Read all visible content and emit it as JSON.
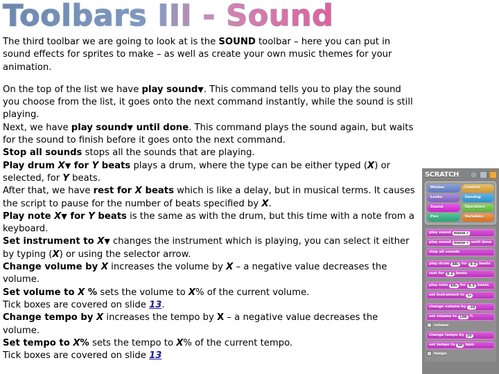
{
  "slide": {
    "title": "Toolbars III - Sound",
    "title_colors": {
      "start": "#7b93b8",
      "end": "#d96fa6"
    },
    "background": "#ffffff"
  },
  "body": {
    "p1": {
      "part1": "The third toolbar we are going to look at is the ",
      "bold1": "SOUND",
      "part2": " toolbar – here you can put in sound effects for sprites to make – as well as create your own music themes for your animation."
    },
    "p2": {
      "l1_a": "On the top of the list we have ",
      "l1_b": "play sound",
      "l1_arrow": "▼",
      "l1_c": ".  This command tells you to play the sound you choose from the list, it goes onto the next command instantly, while the sound is still playing.",
      "l2_a": "Next, we have ",
      "l2_b": "play sound",
      "l2_arrow": "▼",
      "l2_c": " until done",
      "l2_d": ".  This command plays the sound again, but waits for the sound to finish before it goes onto the next command."
    },
    "p3": {
      "b": "Stop all sounds",
      "t": " stops all the sounds that are playing."
    },
    "p4": {
      "b1": "Play drum ",
      "x1": "X",
      "arrow": "▼",
      "b2": " for ",
      "y1": "Y",
      "b3": " beats",
      "t1": " plays a drum, where the type can be either typed (",
      "x2": "X",
      "t2": ") or selected, for ",
      "y2": "Y",
      "t3": " beats."
    },
    "p5": {
      "t1": "After that, we have ",
      "b1": "rest for ",
      "x1": "X",
      "b2": " beats",
      "t2": " which is like a delay, but in musical terms.  It causes the script to pause for the number of beats specified by ",
      "x2": "X",
      "t3": "."
    },
    "p6": {
      "b1": "Play note ",
      "x1": "X",
      "arrow": "▼",
      "b2": " for ",
      "y1": "Y",
      "b3": " beats",
      "t1": " is the same as with the drum, but this time with a note from a keyboard."
    },
    "p7": {
      "b1": "Set instrument to ",
      "x1": "X",
      "arrow": "▼",
      "t1": "  changes the instrument which is playing, you can select it either by typing (",
      "x2": "X",
      "t2": ") or using the selector arrow."
    },
    "p8": {
      "b1": "Change volume by ",
      "x1": "X",
      "t1": " increases the volume by ",
      "x2": "X",
      "t2": " – a negative value decreases the volume."
    },
    "p9": {
      "b1": "Set volume to ",
      "x1": "X",
      "b2": " %",
      "t1": " sets the volume to ",
      "x2": "X",
      "t2": "% of the current volume."
    },
    "p10": {
      "t1": "Tick boxes are covered on slide ",
      "link": "13",
      "t2": "."
    },
    "p11": {
      "b1": "Change tempo by ",
      "x1": "X",
      "t1": " increases the tempo by ",
      "x2": "X",
      "t2": " – a negative value decreases the volume."
    },
    "p12": {
      "b1": "Set tempo to ",
      "x1": "X",
      "b2": "%",
      "t1": " sets the tempo to ",
      "x2": "X",
      "t2": "% of the current tempo."
    },
    "p13": {
      "t1": "Tick boxes are covered on slide ",
      "link": "13"
    }
  },
  "scratch": {
    "logo": "SCRATCH",
    "icons": [
      "globe-icon",
      "save-icon",
      "share-icon"
    ],
    "categories": [
      {
        "label": "Motion",
        "color": "#5f79bd",
        "selected": false
      },
      {
        "label": "Control",
        "color": "#cf9a32",
        "selected": false
      },
      {
        "label": "Looks",
        "color": "#7b5fbd",
        "selected": false
      },
      {
        "label": "Sensing",
        "color": "#2e8fc9",
        "selected": false
      },
      {
        "label": "Sound",
        "color": "#cc22cc",
        "selected": true
      },
      {
        "label": "Operators",
        "color": "#5fb03a",
        "selected": false
      },
      {
        "label": "Pen",
        "color": "#2f9e74",
        "selected": false
      },
      {
        "label": "Variables",
        "color": "#d2701f",
        "selected": false
      }
    ],
    "blocks": [
      {
        "pre": "play sound",
        "field": "meow ▾",
        "post": ""
      },
      {
        "pre": "play sound",
        "field": "meow ▾",
        "post": "until done"
      },
      {
        "pre": "stop all sounds",
        "field": "",
        "post": ""
      },
      {
        "pre": "play drum",
        "field": "48▾",
        "post": "for",
        "field2": "0.2",
        "post2": "beats",
        "gap": true
      },
      {
        "pre": "rest for",
        "field": "0.2",
        "post": "beats"
      },
      {
        "pre": "play note",
        "field": "60▾",
        "post": "for",
        "field2": "0.5",
        "post2": "beats",
        "gap": true
      },
      {
        "pre": "set instrument to",
        "field": "1▾",
        "post": ""
      },
      {
        "pre": "change volume by",
        "field": "-10",
        "post": "",
        "gap": true
      },
      {
        "pre": "set volume to",
        "field": "100",
        "post": "%"
      }
    ],
    "checkbox_volume": "volume",
    "blocks2": [
      {
        "pre": "change tempo by",
        "field": "20",
        "post": ""
      },
      {
        "pre": "set tempo to",
        "field": "60",
        "post": "bpm"
      }
    ],
    "checkbox_tempo": "tempo"
  }
}
